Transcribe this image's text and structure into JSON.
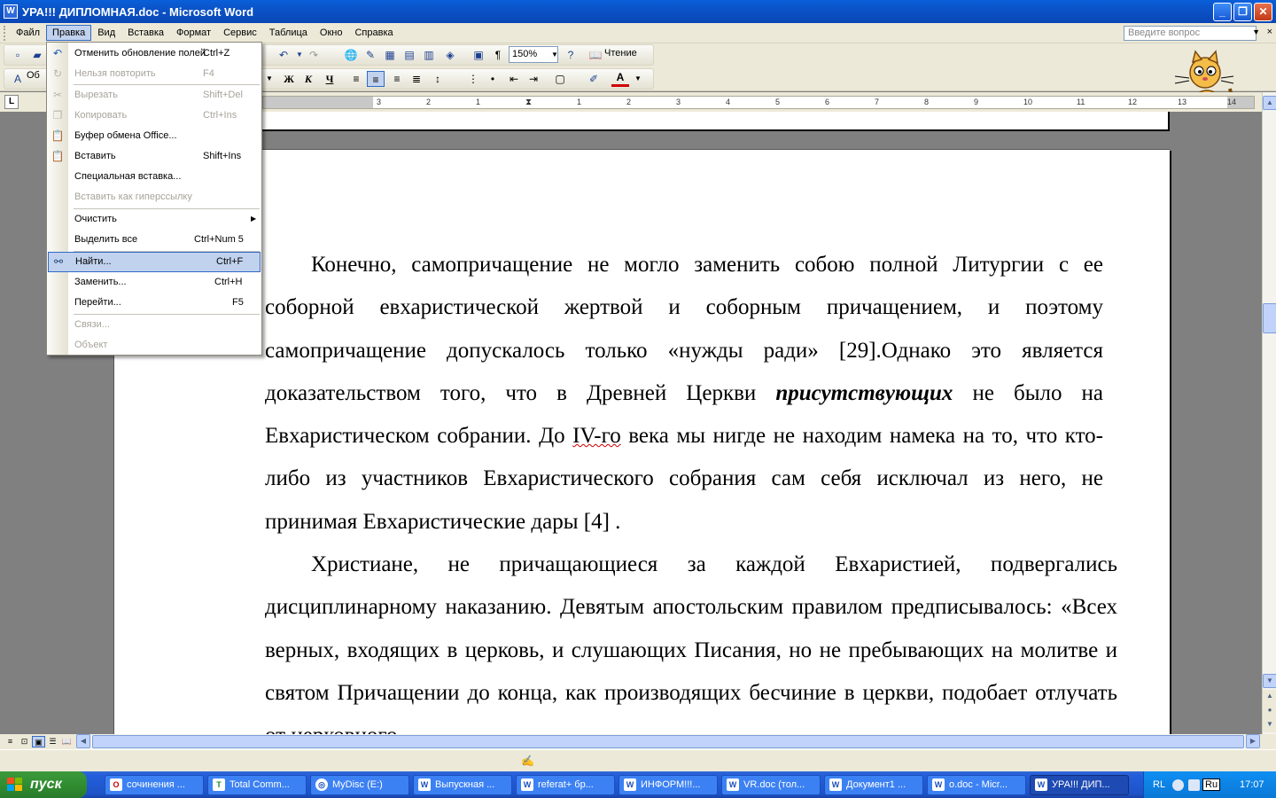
{
  "window": {
    "title": "УРА!!! ДИПЛОМНАЯ.doc - Microsoft Word",
    "app_icon": "W",
    "controls": {
      "minimize": "_",
      "restore": "❐",
      "close": "✕"
    }
  },
  "menubar": {
    "items": [
      "Файл",
      "Правка",
      "Вид",
      "Вставка",
      "Формат",
      "Сервис",
      "Таблица",
      "Окно",
      "Справка"
    ],
    "open_index": 1,
    "help_placeholder": "Введите вопрос",
    "close_doc": "×"
  },
  "toolbar": {
    "zoom": "150%",
    "reading": "Чтение",
    "style_prefix": "Об",
    "bold": "Ж",
    "italic": "К",
    "underline": "Ч",
    "para_mark": "¶",
    "font_color_letter": "A"
  },
  "edit_menu": {
    "items": [
      {
        "label": "Отменить обновление полей",
        "shortcut": "Ctrl+Z",
        "icon": "undo-icon",
        "disabled": false
      },
      {
        "label": "Нельзя повторить",
        "shortcut": "F4",
        "icon": "redo-icon",
        "disabled": true
      },
      {
        "label": "Вырезать",
        "shortcut": "Shift+Del",
        "icon": "scissors-icon",
        "disabled": true
      },
      {
        "label": "Копировать",
        "shortcut": "Ctrl+Ins",
        "icon": "copy-icon",
        "disabled": true
      },
      {
        "label": "Буфер обмена Office...",
        "shortcut": "",
        "icon": "clipboard-icon",
        "disabled": false
      },
      {
        "label": "Вставить",
        "shortcut": "Shift+Ins",
        "icon": "paste-icon",
        "disabled": false
      },
      {
        "label": "Специальная вставка...",
        "shortcut": "",
        "icon": "",
        "disabled": false
      },
      {
        "label": "Вставить как гиперссылку",
        "shortcut": "",
        "icon": "",
        "disabled": true
      },
      {
        "label": "Очистить",
        "shortcut": "",
        "icon": "",
        "disabled": false,
        "submenu": true
      },
      {
        "label": "Выделить все",
        "shortcut": "Ctrl+Num 5",
        "icon": "",
        "disabled": false
      },
      {
        "label": "Найти...",
        "shortcut": "Ctrl+F",
        "icon": "binoculars-icon",
        "disabled": false,
        "highlighted": true
      },
      {
        "label": "Заменить...",
        "shortcut": "Ctrl+H",
        "icon": "",
        "disabled": false
      },
      {
        "label": "Перейти...",
        "shortcut": "F5",
        "icon": "",
        "disabled": false
      },
      {
        "label": "Связи...",
        "shortcut": "",
        "icon": "",
        "disabled": true
      },
      {
        "label": "Объект",
        "shortcut": "",
        "icon": "",
        "disabled": true
      }
    ]
  },
  "ruler": {
    "ticks": [
      "3",
      "2",
      "1",
      "1",
      "2",
      "3",
      "4",
      "5",
      "6",
      "7",
      "8",
      "9",
      "10",
      "11",
      "12",
      "13",
      "14"
    ]
  },
  "document": {
    "para1_a": "Конечно, самопричащение не могло заменить собою полной Литургии с ее соборной евхаристической жертвой и соборным причащением, и поэтому самопричащение допускалось только «нужды ради» [29].Однако это является доказательством того, что в Древней Церкви ",
    "para1_emph": "присутствующих",
    "para1_b": " не было на Евхаристическом собрании. До ",
    "para1_spell": "IV-го",
    "para1_c": " века мы нигде не находим намека на то, что кто-либо из участников Евхаристического собрания сам себя исключал из него, не принимая Евхаристические дары [4] .",
    "para2": "Христиане, не причащающиеся за каждой Евхаристией, подвергались дисциплинарному наказанию. Девятым апостольским правилом предписывалось: «Всех верных, входящих в церковь, и слушающих Писания, но не пребывающих на молитве и святом Причащении до конца, как производящих бесчиние в церкви, подобает отлучать от церковного"
  },
  "taskbar": {
    "start_label": "пуск",
    "tasks": [
      {
        "label": "сочинения ...",
        "icon": "opera-icon"
      },
      {
        "label": "Total Comm...",
        "icon": "total-commander-icon"
      },
      {
        "label": "MyDisc (E:)",
        "icon": "disc-icon"
      },
      {
        "label": "Выпускная ...",
        "icon": "word-icon"
      },
      {
        "label": "referat+ бр...",
        "icon": "word-icon"
      },
      {
        "label": "ИНФОРМ!!!...",
        "icon": "word-icon"
      },
      {
        "label": "VR.doc (тол...",
        "icon": "word-icon"
      },
      {
        "label": "Документ1 ...",
        "icon": "word-icon"
      },
      {
        "label": "o.doc - Micr...",
        "icon": "word-icon"
      },
      {
        "label": "УРА!!! ДИП...",
        "icon": "word-icon",
        "active": true
      }
    ],
    "tray": {
      "lang": "RL",
      "keyboard": "Ru",
      "time": "17:07"
    }
  },
  "colors": {
    "titlebar": "#0a5fd8",
    "menu_bg": "#ece9d8",
    "highlight": "#c1d2ee",
    "taskbar": "#245edb",
    "start": "#2f8a2f"
  }
}
